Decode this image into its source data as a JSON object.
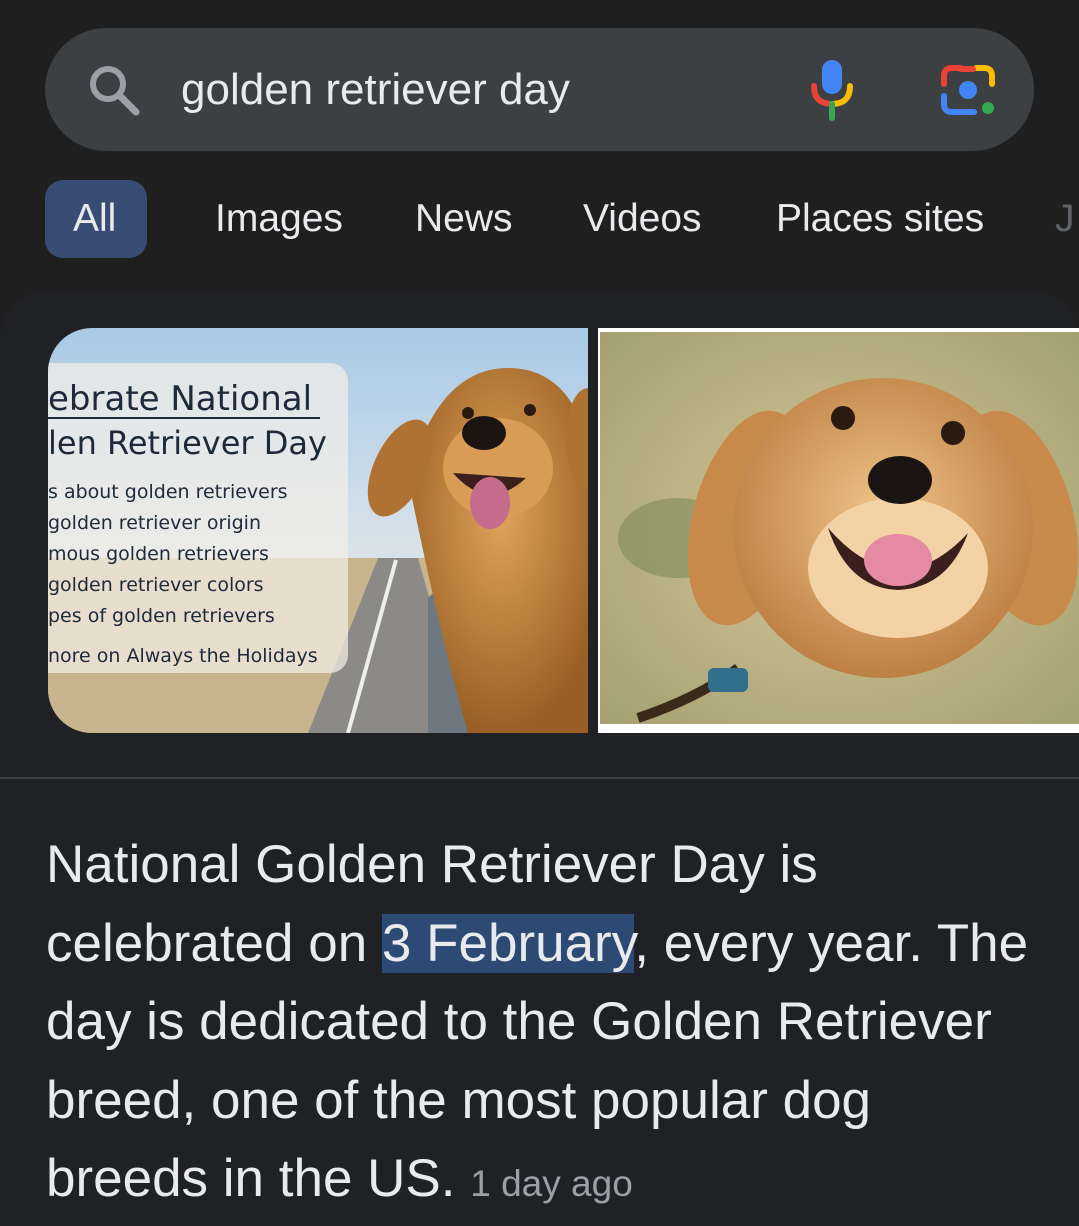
{
  "search": {
    "query": "golden retriever day"
  },
  "tabs": [
    {
      "label": "All",
      "active": true
    },
    {
      "label": "Images"
    },
    {
      "label": "News"
    },
    {
      "label": "Videos"
    },
    {
      "label": "Places sites"
    },
    {
      "label": "J"
    }
  ],
  "images": {
    "first": {
      "overlay_title_1": "ebrate National",
      "overlay_title_2": "len Retriever Day",
      "overlay_lines": [
        "s about golden retrievers",
        "golden retriever origin",
        "mous golden retrievers",
        "golden retriever colors",
        "pes of golden retrievers",
        "nore on Always the Holidays"
      ]
    }
  },
  "snippet": {
    "text_before": "National Golden Retriever Day is celebrated on ",
    "highlight": "3 February",
    "text_after": ", every year. The day is dedicated to the Golden Retriever breed, one of the most popular dog breeds in the US.",
    "timestamp": "1 day ago"
  },
  "colors": {
    "background": "#1f1f1f",
    "searchbar": "#3c4043",
    "active_tab": "#394c73",
    "highlight": "#2c4a73",
    "text": "#e8eaed",
    "muted": "#9aa0a6"
  },
  "icons": [
    "search-icon",
    "microphone-icon",
    "google-lens-icon"
  ]
}
